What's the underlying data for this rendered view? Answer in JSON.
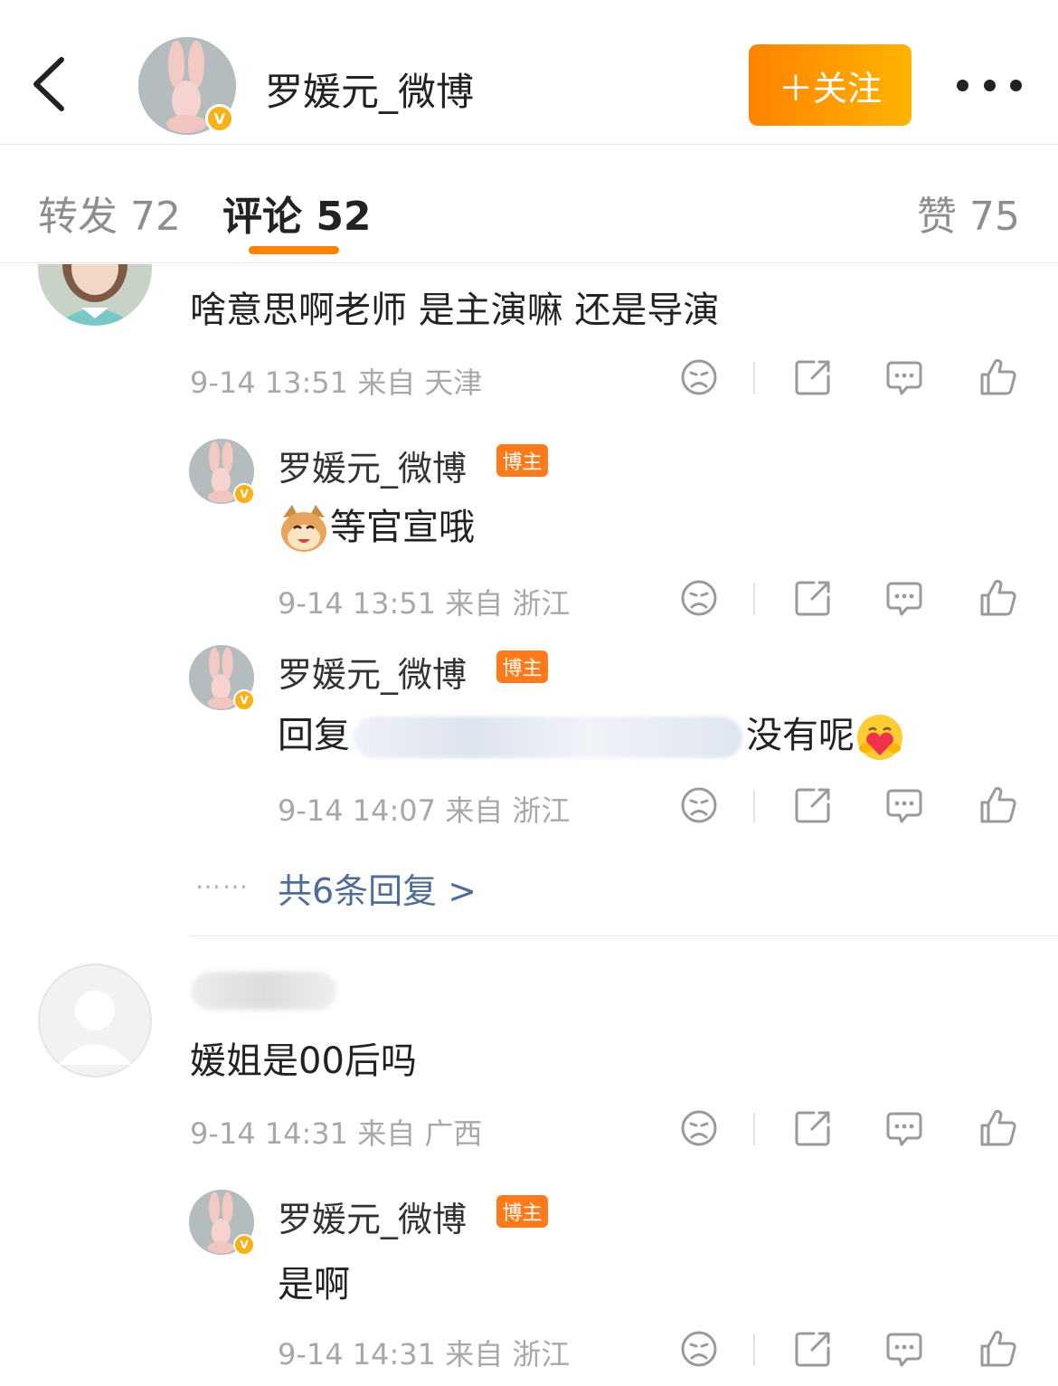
{
  "header": {
    "back_icon": "chevron-left-icon",
    "name": "罗媛元_微博",
    "follow_label": "＋关注",
    "more_icon": "more-dots-icon",
    "verified_icon": "v-verified-icon"
  },
  "tabs": [
    {
      "label": "转发 72"
    },
    {
      "label": "评论 52"
    },
    {
      "label": "赞 75"
    }
  ],
  "colors": {
    "accent": "#ff8200",
    "link": "#4f6d96",
    "author_badge": "#ff7a1a"
  },
  "comments": [
    {
      "text": "啥意思啊老师 是主演嘛 还是导演",
      "meta": "9-14 13:51 来自 天津",
      "replies": [
        {
          "name": "罗媛元_微博",
          "badge": "博主",
          "text": "等官宣哦",
          "emoji": "cat-emoji",
          "meta": "9-14 13:51 来自 浙江"
        },
        {
          "name": "罗媛元_微博",
          "badge": "博主",
          "text_prefix": "回复",
          "text_suffix": "没有呢",
          "emoji": "heart-hug-emoji",
          "meta": "9-14 14:07 来自 浙江"
        }
      ],
      "more_replies": "共6条回复 >",
      "dots": "……"
    },
    {
      "text": "媛姐是00后吗",
      "meta": "9-14 14:31 来自 广西",
      "replies": [
        {
          "name": "罗媛元_微博",
          "badge": "博主",
          "text": "是啊",
          "meta": "9-14 14:31 来自 浙江"
        }
      ]
    }
  ],
  "action_icons": [
    "dislike-face-icon",
    "share-icon",
    "comment-icon",
    "like-icon"
  ]
}
